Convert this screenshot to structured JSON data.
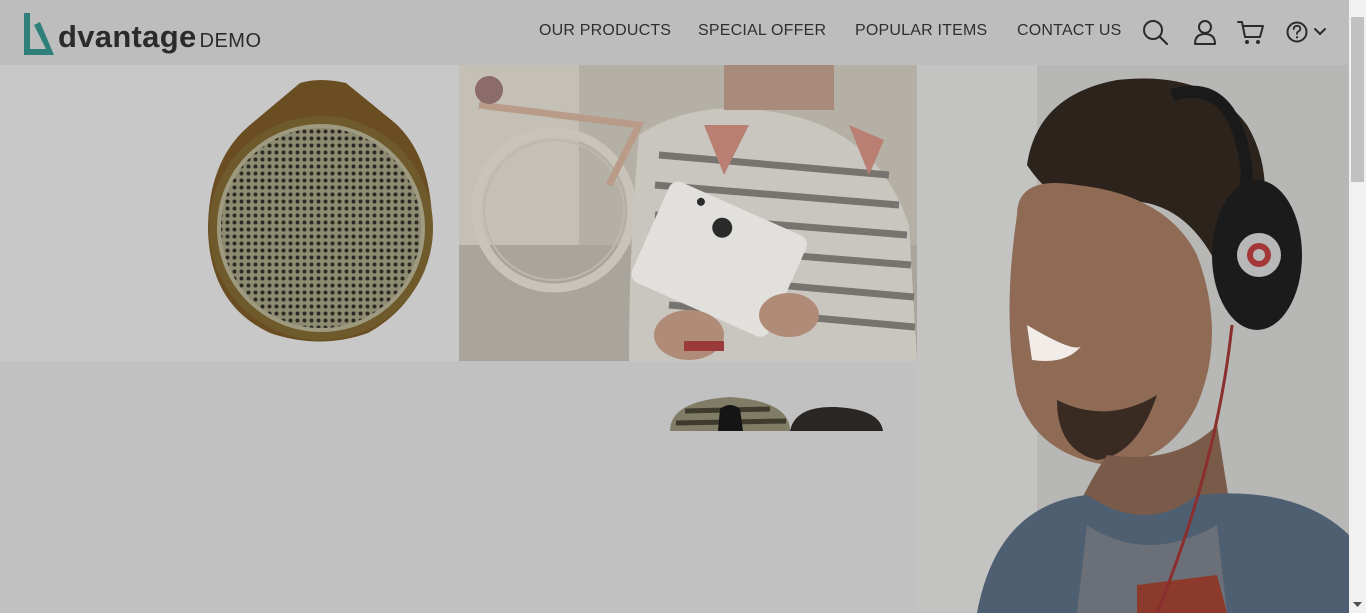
{
  "header": {
    "logo": {
      "word": "dvantage",
      "demo": "DEMO"
    },
    "nav": [
      {
        "label": "OUR PRODUCTS"
      },
      {
        "label": "SPECIAL OFFER"
      },
      {
        "label": "POPULAR ITEMS"
      },
      {
        "label": "CONTACT US"
      }
    ],
    "icons": [
      "search-icon",
      "user-icon",
      "cart-icon",
      "help-icon",
      "chevron-down-icon"
    ]
  },
  "tiles": [
    {
      "name": "speaker",
      "image": "speaker-image"
    },
    {
      "name": "tablet",
      "image": "tablet-image"
    },
    {
      "name": "headphones",
      "image": "headphones-image"
    },
    {
      "name": "mice",
      "image": "mice-image"
    }
  ],
  "colors": {
    "brand_teal": "#2f7f7a",
    "overlay": "#000000",
    "header_bg": "#bdbdbd"
  }
}
